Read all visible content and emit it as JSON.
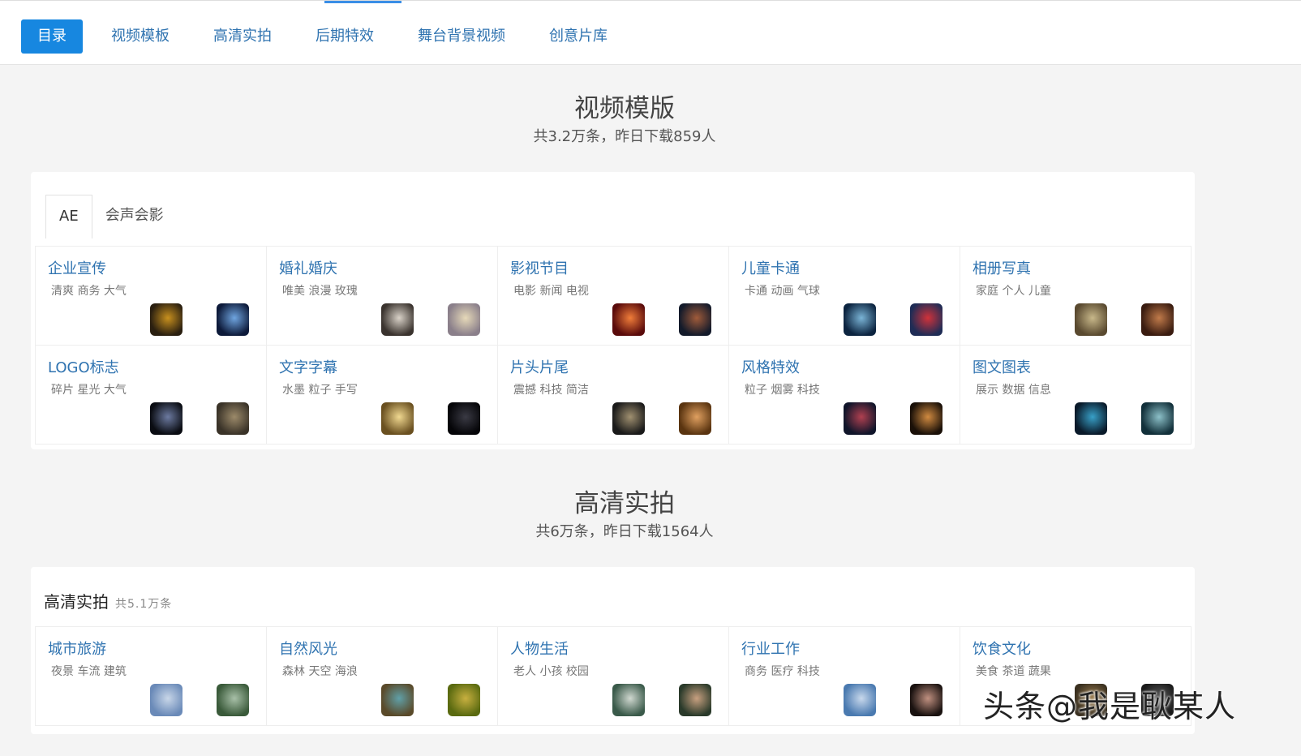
{
  "nav": {
    "items": [
      "目录",
      "视频模板",
      "高清实拍",
      "后期特效",
      "舞台背景视频",
      "创意片库"
    ]
  },
  "sections": [
    {
      "title": "视频模版",
      "subtitle": "共3.2万条，昨日下载859人",
      "tabs": [
        "AE",
        "会声会影"
      ],
      "categories": [
        {
          "name": "企业宣传",
          "tags": "清爽 商务 大气",
          "thumbs": [
            [
              "#2a1f10",
              "#c8901e"
            ],
            [
              "#0d1a3a",
              "#6fa5e0"
            ]
          ]
        },
        {
          "name": "婚礼婚庆",
          "tags": "唯美 浪漫 玫瑰",
          "thumbs": [
            [
              "#3a332e",
              "#d9d2c8"
            ],
            [
              "#8a7f8a",
              "#e6d9b9"
            ]
          ]
        },
        {
          "name": "影视节目",
          "tags": "电影 新闻 电视",
          "thumbs": [
            [
              "#5a0b0b",
              "#f07d3a"
            ],
            [
              "#131a2a",
              "#a05b3a"
            ]
          ]
        },
        {
          "name": "儿童卡通",
          "tags": "卡通 动画 气球",
          "thumbs": [
            [
              "#0c2440",
              "#7ab4d6"
            ],
            [
              "#1f2c55",
              "#d0323a"
            ]
          ]
        },
        {
          "name": "相册写真",
          "tags": "家庭 个人 儿童",
          "thumbs": [
            [
              "#5a4a30",
              "#c8b88a"
            ],
            [
              "#3a1c10",
              "#c07a4a"
            ]
          ]
        },
        {
          "name": "LOGO标志",
          "tags": "碎片 星光 大气",
          "thumbs": [
            [
              "#0a0c12",
              "#6c7aa0"
            ],
            [
              "#3a3328",
              "#9c8a6a"
            ]
          ]
        },
        {
          "name": "文字字幕",
          "tags": "水墨 粒子 手写",
          "thumbs": [
            [
              "#6a5020",
              "#f0d890"
            ],
            [
              "#050508",
              "#3a3a44"
            ]
          ]
        },
        {
          "name": "片头片尾",
          "tags": "震撼 科技 简洁",
          "thumbs": [
            [
              "#1a1a1a",
              "#a09070"
            ],
            [
              "#5a3410",
              "#e0a060"
            ]
          ]
        },
        {
          "name": "风格特效",
          "tags": "粒子 烟雾 科技",
          "thumbs": [
            [
              "#10152a",
              "#b04050"
            ],
            [
              "#1a1008",
              "#d08a40"
            ]
          ]
        },
        {
          "name": "图文图表",
          "tags": "展示 数据 信息",
          "thumbs": [
            [
              "#0a1a2a",
              "#38a0c8"
            ],
            [
              "#12303a",
              "#8cc0c8"
            ]
          ]
        }
      ]
    },
    {
      "title": "高清实拍",
      "subtitle": "共6万条，昨日下载1564人",
      "panel_title": "高清实拍",
      "panel_count": "共5.1万条",
      "categories": [
        {
          "name": "城市旅游",
          "tags": "夜景 车流 建筑",
          "thumbs": [
            [
              "#6a8ab8",
              "#c8d6e8"
            ],
            [
              "#3a5a3a",
              "#a8c0a8"
            ]
          ]
        },
        {
          "name": "自然风光",
          "tags": "森林 天空 海浪",
          "thumbs": [
            [
              "#5a4a2a",
              "#60a0a8"
            ],
            [
              "#5a6a10",
              "#c8b040"
            ]
          ]
        },
        {
          "name": "人物生活",
          "tags": "老人 小孩 校园",
          "thumbs": [
            [
              "#3a5a4a",
              "#d0d8d0"
            ],
            [
              "#2a3a2a",
              "#c8a080"
            ]
          ]
        },
        {
          "name": "行业工作",
          "tags": "商务 医疗 科技",
          "thumbs": [
            [
              "#4a7ab0",
              "#c8d8ec"
            ],
            [
              "#1a1210",
              "#c09080"
            ]
          ]
        },
        {
          "name": "饮食文化",
          "tags": "美食 茶道 蔬果",
          "thumbs": [
            [
              "#3a3020",
              "#a08050"
            ],
            [
              "#1a1a1a",
              "#606060"
            ]
          ]
        }
      ]
    }
  ],
  "watermark": "头条@我是耿某人"
}
